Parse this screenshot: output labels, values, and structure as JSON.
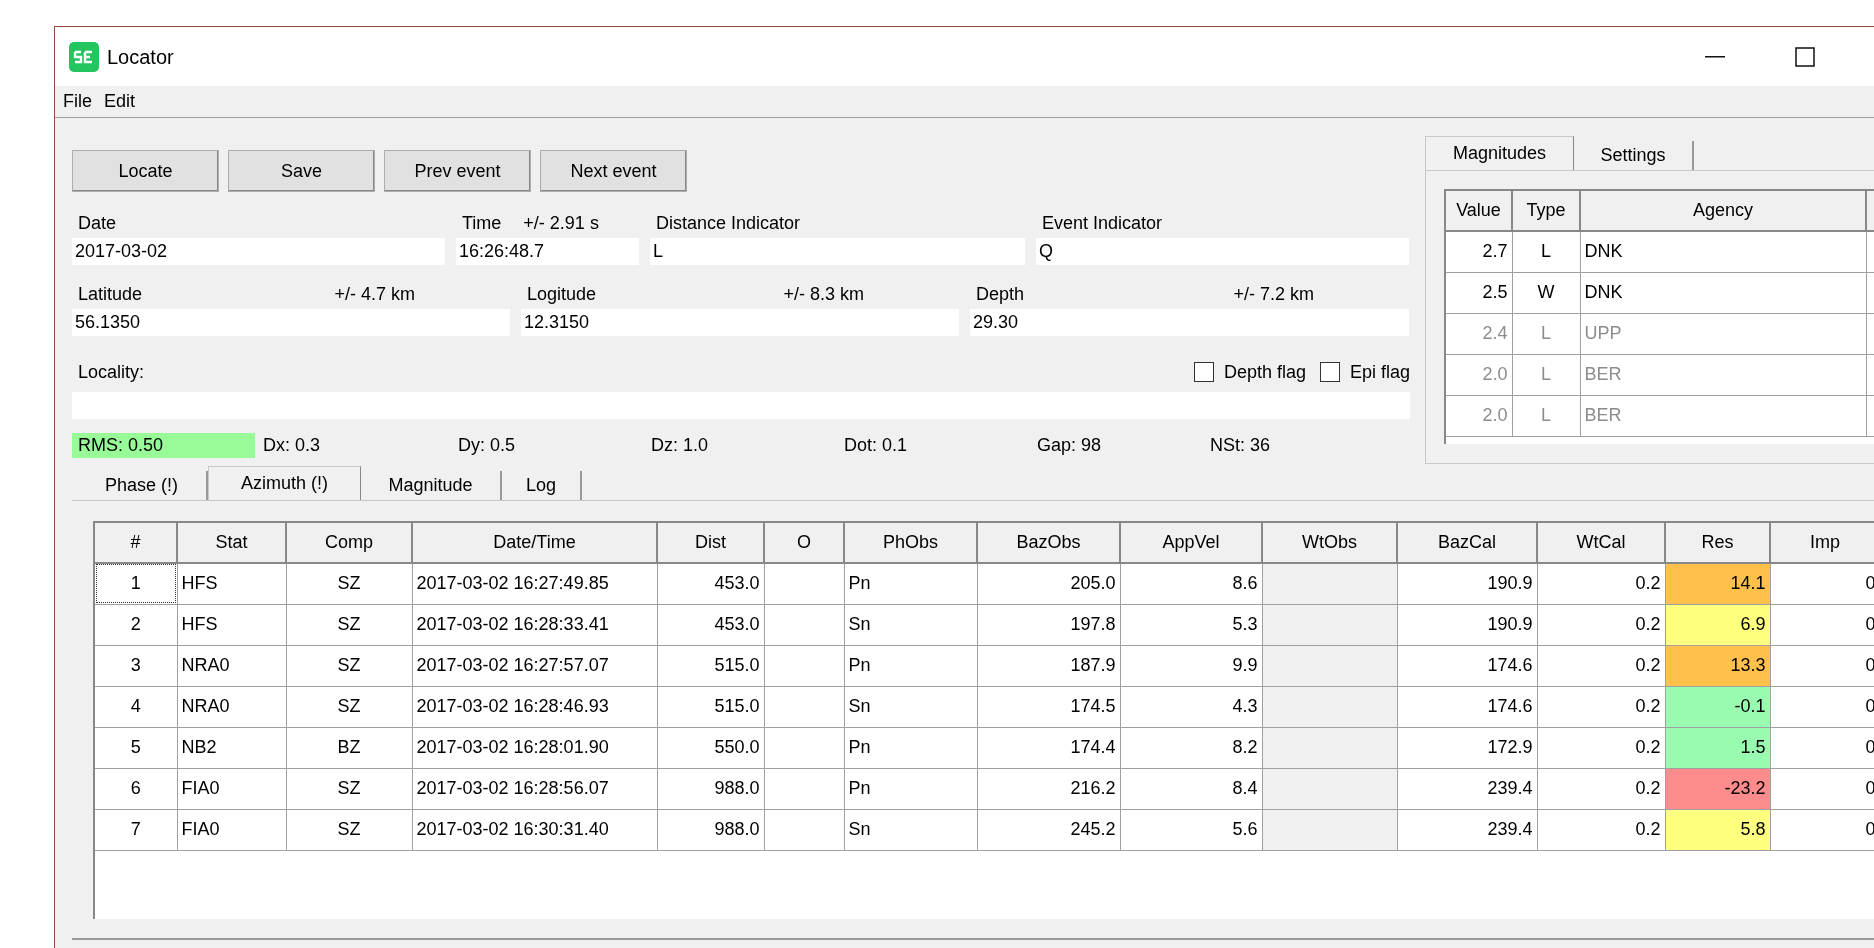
{
  "window": {
    "title": "Locator"
  },
  "menu": [
    "File",
    "Edit"
  ],
  "buttons": [
    "Locate",
    "Save",
    "Prev event",
    "Next event"
  ],
  "row1": [
    {
      "label": "Date",
      "value": "2017-03-02"
    },
    {
      "label": "Time",
      "uncertainty": "+/- 2.91 s",
      "value": "16:26:48.7"
    },
    {
      "label": "Distance Indicator",
      "value": "L"
    },
    {
      "label": "Event Indicator",
      "value": "Q"
    }
  ],
  "row2": [
    {
      "label": "Latitude",
      "uncertainty": "+/- 4.7 km",
      "value": "56.1350"
    },
    {
      "label": "Logitude",
      "uncertainty": "+/- 8.3 km",
      "value": "12.3150"
    },
    {
      "label": "Depth",
      "uncertainty": "+/- 7.2 km",
      "value": "29.30"
    }
  ],
  "locality": {
    "label": "Locality:"
  },
  "flags": [
    {
      "label": "Depth flag",
      "checked": false
    },
    {
      "label": "Epi flag",
      "checked": false
    }
  ],
  "rms": {
    "text": "RMS: 0.50",
    "color": "#98fb98"
  },
  "stats": [
    "Dx: 0.3",
    "Dy: 0.5",
    "Dz: 1.0",
    "Dot: 0.1",
    "Gap: 98",
    "NSt: 36"
  ],
  "tabs": [
    {
      "label": "Phase (!)",
      "selected": false
    },
    {
      "label": "Azimuth (!)",
      "selected": true
    },
    {
      "label": "Magnitude",
      "selected": false
    },
    {
      "label": "Log",
      "selected": false
    }
  ],
  "table": {
    "columns": [
      {
        "label": "#",
        "disabled": false
      },
      {
        "label": "Stat",
        "disabled": false
      },
      {
        "label": "Comp",
        "disabled": false
      },
      {
        "label": "Date/Time",
        "disabled": false
      },
      {
        "label": "Dist",
        "disabled": false
      },
      {
        "label": "O",
        "disabled": false
      },
      {
        "label": "PhObs",
        "disabled": false
      },
      {
        "label": "BazObs",
        "disabled": false
      },
      {
        "label": "AppVel",
        "disabled": false
      },
      {
        "label": "WtObs",
        "disabled": true
      },
      {
        "label": "BazCal",
        "disabled": false
      },
      {
        "label": "WtCal",
        "disabled": false
      },
      {
        "label": "Res",
        "disabled": false
      },
      {
        "label": "Imp",
        "disabled": false
      }
    ],
    "rows": [
      {
        "cells": [
          "1",
          "HFS",
          "SZ",
          "2017-03-02 16:27:49.85",
          "453.0",
          "",
          "Pn",
          "205.0",
          "8.6",
          "",
          "190.9",
          "0.2",
          "14.1",
          "0"
        ],
        "color": "#ffc04c"
      },
      {
        "cells": [
          "2",
          "HFS",
          "SZ",
          "2017-03-02 16:28:33.41",
          "453.0",
          "",
          "Sn",
          "197.8",
          "5.3",
          "",
          "190.9",
          "0.2",
          "6.9",
          "0"
        ],
        "color": "#ffff80"
      },
      {
        "cells": [
          "3",
          "NRA0",
          "SZ",
          "2017-03-02 16:27:57.07",
          "515.0",
          "",
          "Pn",
          "187.9",
          "9.9",
          "",
          "174.6",
          "0.2",
          "13.3",
          "0"
        ],
        "color": "#ffc04c"
      },
      {
        "cells": [
          "4",
          "NRA0",
          "SZ",
          "2017-03-02 16:28:46.93",
          "515.0",
          "",
          "Sn",
          "174.5",
          "4.3",
          "",
          "174.6",
          "0.2",
          "-0.1",
          "0"
        ],
        "color": "#98fbb0"
      },
      {
        "cells": [
          "5",
          "NB2",
          "BZ",
          "2017-03-02 16:28:01.90",
          "550.0",
          "",
          "Pn",
          "174.4",
          "8.2",
          "",
          "172.9",
          "0.2",
          "1.5",
          "0"
        ],
        "color": "#98fbb0"
      },
      {
        "cells": [
          "6",
          "FIA0",
          "SZ",
          "2017-03-02 16:28:56.07",
          "988.0",
          "",
          "Pn",
          "216.2",
          "8.4",
          "",
          "239.4",
          "0.2",
          "-23.2",
          "0"
        ],
        "color": "#ff8c8c"
      },
      {
        "cells": [
          "7",
          "FIA0",
          "SZ",
          "2017-03-02 16:30:31.40",
          "988.0",
          "",
          "Sn",
          "245.2",
          "5.6",
          "",
          "239.4",
          "0.2",
          "5.8",
          "0"
        ],
        "color": "#ffff80"
      }
    ]
  },
  "magnitudes": {
    "tabs": [
      {
        "label": "Magnitudes",
        "selected": true
      },
      {
        "label": "Settings",
        "selected": false
      }
    ],
    "columns": [
      "Value",
      "Type",
      "Agency"
    ],
    "rows": [
      {
        "cells": [
          "2.7",
          "L",
          "DNK"
        ],
        "disabled": false
      },
      {
        "cells": [
          "2.5",
          "W",
          "DNK"
        ],
        "disabled": false
      },
      {
        "cells": [
          "2.4",
          "L",
          "UPP"
        ],
        "disabled": true
      },
      {
        "cells": [
          "2.0",
          "L",
          "BER"
        ],
        "disabled": true
      },
      {
        "cells": [
          "2.0",
          "L",
          "BER"
        ],
        "disabled": true
      }
    ]
  }
}
